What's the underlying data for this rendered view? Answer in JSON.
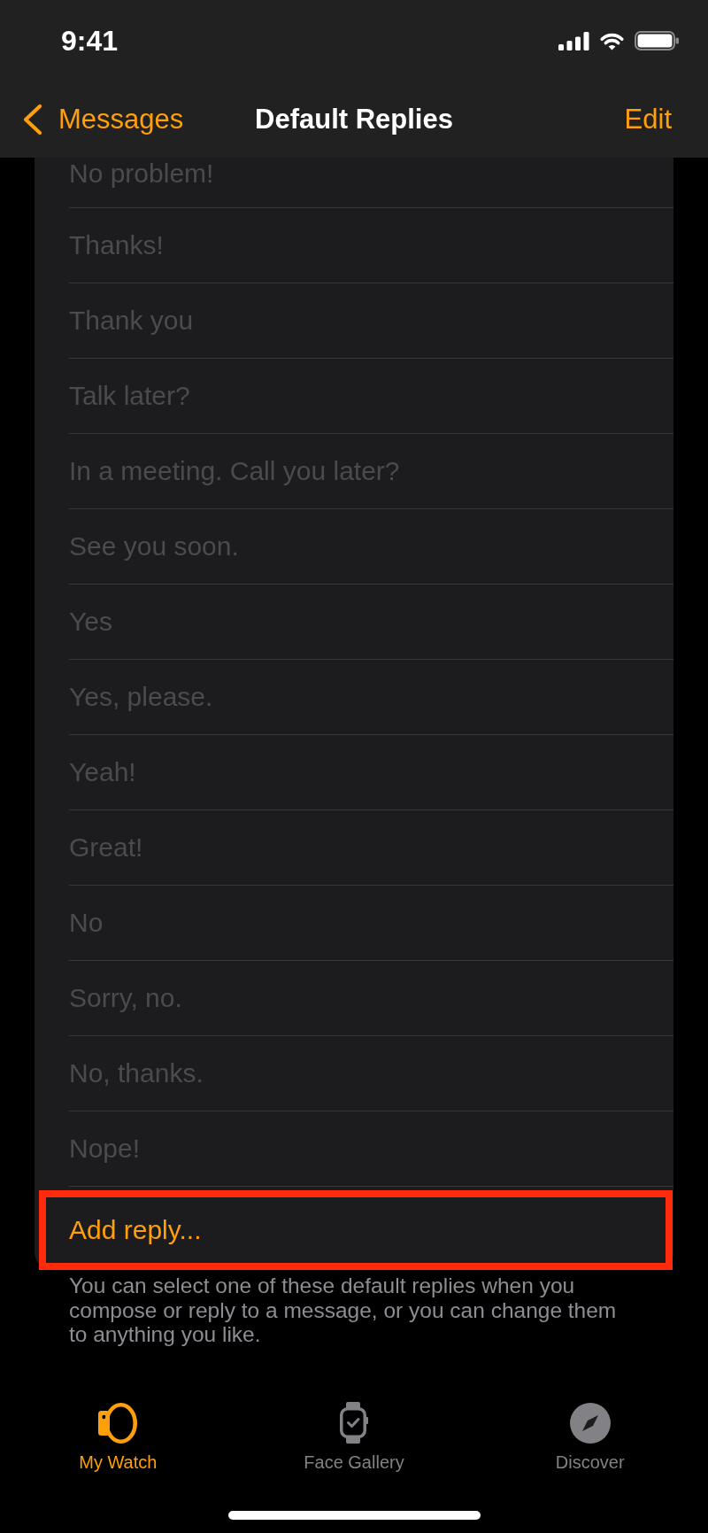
{
  "status_bar": {
    "time": "9:41"
  },
  "nav": {
    "back": "Messages",
    "title": "Default Replies",
    "action": "Edit"
  },
  "replies": [
    {
      "text": "No problem!",
      "disabled": true
    },
    {
      "text": "Thanks!",
      "disabled": true
    },
    {
      "text": "Thank you",
      "disabled": true
    },
    {
      "text": "Talk later?",
      "disabled": true
    },
    {
      "text": "In a meeting. Call you later?",
      "disabled": true
    },
    {
      "text": "See you soon.",
      "disabled": true
    },
    {
      "text": "Yes",
      "disabled": true
    },
    {
      "text": "Yes, please.",
      "disabled": true
    },
    {
      "text": "Yeah!",
      "disabled": true
    },
    {
      "text": "Great!",
      "disabled": true
    },
    {
      "text": "No",
      "disabled": true
    },
    {
      "text": "Sorry, no.",
      "disabled": true
    },
    {
      "text": "No, thanks.",
      "disabled": true
    },
    {
      "text": "Nope!",
      "disabled": true
    }
  ],
  "add_reply": {
    "label": "Add reply...",
    "highlighted": true
  },
  "footer": "You can select one of these default replies when you compose or reply to a message, or you can change them to anything you like.",
  "tabs": [
    {
      "label": "My Watch",
      "selected": true
    },
    {
      "label": "Face Gallery",
      "selected": false
    },
    {
      "label": "Discover",
      "selected": false
    }
  ]
}
